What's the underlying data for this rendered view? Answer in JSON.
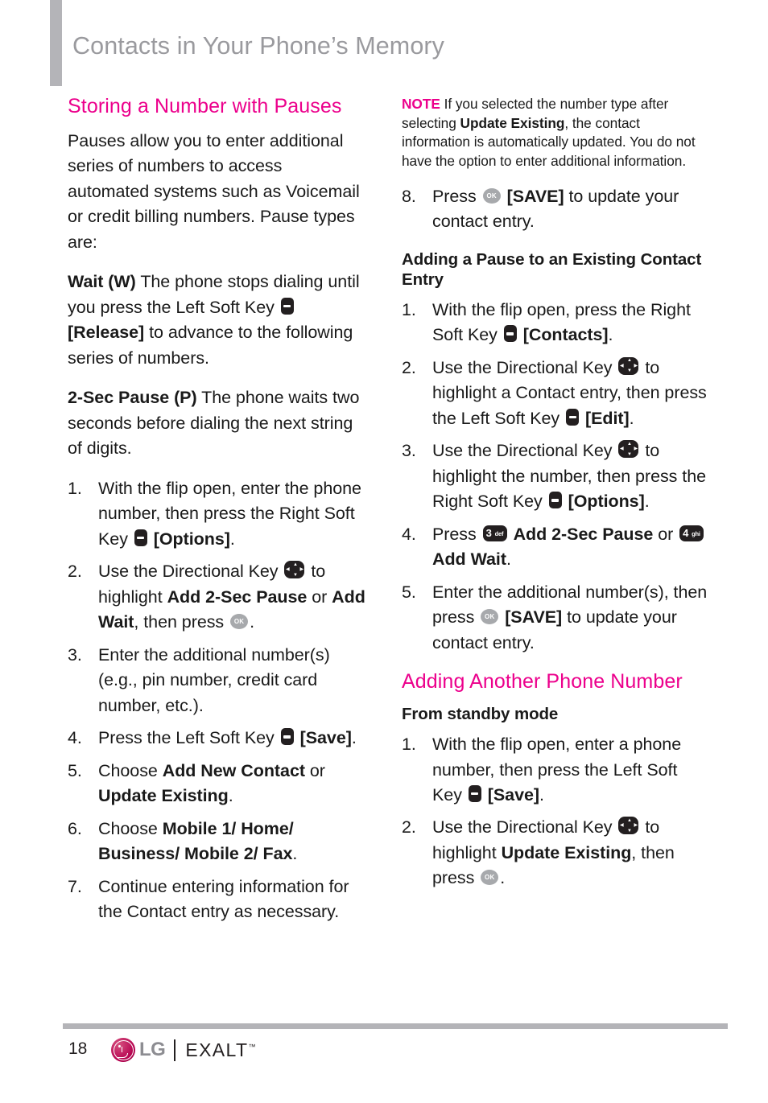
{
  "header": {
    "title": "Contacts in Your Phone’s Memory"
  },
  "icons": {
    "soft_key": "soft-key-icon",
    "directional_key": "directional-key-icon",
    "ok_key": "ok-key-icon",
    "num_key_3": "number-key-3-def-icon",
    "num_key_4": "number-key-4-ghi-icon",
    "ok_label": "OK",
    "num3_digit": "3",
    "num3_letters": "def",
    "num4_digit": "4",
    "num4_letters": "ghi"
  },
  "colors": {
    "accent_pink": "#ec008c",
    "header_gray": "#9a9a9e",
    "rule_gray": "#b4b4b8",
    "key_dark": "#231f20",
    "ok_gray": "#a7a9ac",
    "lg_crimson": "#b4004e"
  },
  "left_column": {
    "section_heading": "Storing a Number with Pauses",
    "intro_paragraph": "Pauses allow you to enter additional series of numbers to access automated systems such as Voicemail or credit billing numbers. Pause types are:",
    "wait_term": "Wait (W)",
    "wait_text_1": " The phone stops dialing until you press the Left Soft Key ",
    "wait_bracket": "[Release]",
    "wait_text_2": " to advance to the following series of numbers.",
    "twosec_term": "2-Sec Pause (P)",
    "twosec_text": " The phone waits two seconds before dialing the next string of digits.",
    "steps": [
      {
        "num": "1.",
        "parts": [
          {
            "t": "With the flip open, enter the phone number, then press the Right Soft Key "
          },
          {
            "icon": "soft"
          },
          {
            "t": " ",
            "bold": false
          },
          {
            "t": "[Options]",
            "bold": true
          },
          {
            "t": "."
          }
        ]
      },
      {
        "num": "2.",
        "parts": [
          {
            "t": "Use the Directional Key "
          },
          {
            "icon": "dir"
          },
          {
            "t": " to highlight "
          },
          {
            "t": "Add 2-Sec Pause",
            "bold": true
          },
          {
            "t": " or "
          },
          {
            "t": "Add Wait",
            "bold": true
          },
          {
            "t": ", then press "
          },
          {
            "icon": "ok"
          },
          {
            "t": "."
          }
        ]
      },
      {
        "num": "3.",
        "parts": [
          {
            "t": "Enter the additional number(s) (e.g., pin number, credit card number, etc.)."
          }
        ]
      },
      {
        "num": "4.",
        "parts": [
          {
            "t": "Press the Left Soft Key "
          },
          {
            "icon": "soft"
          },
          {
            "t": " "
          },
          {
            "t": "[Save]",
            "bold": true
          },
          {
            "t": "."
          }
        ]
      },
      {
        "num": "5.",
        "parts": [
          {
            "t": "Choose "
          },
          {
            "t": "Add New Contact",
            "bold": true
          },
          {
            "t": " or "
          },
          {
            "t": "Update Existing",
            "bold": true
          },
          {
            "t": "."
          }
        ]
      },
      {
        "num": "6.",
        "parts": [
          {
            "t": "Choose "
          },
          {
            "t": "Mobile 1/ Home/ Business/ Mobile 2/ Fax",
            "bold": true
          },
          {
            "t": "."
          }
        ]
      },
      {
        "num": "7.",
        "parts": [
          {
            "t": "Continue entering information for the Contact entry as necessary."
          }
        ]
      }
    ]
  },
  "right_column": {
    "note_label": "NOTE",
    "note_text_1": " If you selected the number type after selecting ",
    "note_bold": "Update Existing",
    "note_text_2": ", the contact information is automatically updated. You do not have the option to enter additional information.",
    "step8": {
      "num": "8.",
      "text_1": "Press ",
      "bracket": "[SAVE]",
      "text_2": " to update your contact entry."
    },
    "sub_heading_1": "Adding a Pause to an Existing Contact Entry",
    "steps_pause": [
      {
        "num": "1.",
        "parts": [
          {
            "t": "With the flip open, press the Right Soft Key "
          },
          {
            "icon": "soft"
          },
          {
            "t": " "
          },
          {
            "t": "[Contacts]",
            "bold": true
          },
          {
            "t": "."
          }
        ]
      },
      {
        "num": "2.",
        "parts": [
          {
            "t": "Use the Directional Key "
          },
          {
            "icon": "dir"
          },
          {
            "t": " to highlight a Contact entry, then press the Left Soft Key "
          },
          {
            "icon": "soft"
          },
          {
            "t": " "
          },
          {
            "t": "[Edit]",
            "bold": true
          },
          {
            "t": "."
          }
        ]
      },
      {
        "num": "3.",
        "parts": [
          {
            "t": "Use the Directional Key "
          },
          {
            "icon": "dir"
          },
          {
            "t": " to highlight the number, then press the Right Soft Key "
          },
          {
            "icon": "soft"
          },
          {
            "t": " "
          },
          {
            "t": "[Options]",
            "bold": true
          },
          {
            "t": "."
          }
        ]
      },
      {
        "num": "4.",
        "parts": [
          {
            "t": "Press "
          },
          {
            "icon": "num3"
          },
          {
            "t": " "
          },
          {
            "t": "Add 2-Sec Pause",
            "bold": true
          },
          {
            "t": " or "
          },
          {
            "icon": "num4"
          },
          {
            "t": " "
          },
          {
            "t": "Add Wait",
            "bold": true
          },
          {
            "t": "."
          }
        ]
      },
      {
        "num": "5.",
        "parts": [
          {
            "t": "Enter the additional number(s), then press "
          },
          {
            "icon": "ok"
          },
          {
            "t": " "
          },
          {
            "t": "[SAVE]",
            "bold": true
          },
          {
            "t": " to update your contact entry."
          }
        ]
      }
    ],
    "section_heading_2": "Adding Another Phone Number",
    "sub_heading_2": "From standby mode",
    "steps_standby": [
      {
        "num": "1.",
        "parts": [
          {
            "t": "With the flip open, enter a phone number, then press the Left Soft Key "
          },
          {
            "icon": "soft"
          },
          {
            "t": " "
          },
          {
            "t": "[Save]",
            "bold": true
          },
          {
            "t": "."
          }
        ]
      },
      {
        "num": "2.",
        "parts": [
          {
            "t": "Use the Directional Key "
          },
          {
            "icon": "dir"
          },
          {
            "t": " to highlight "
          },
          {
            "t": "Update Existing",
            "bold": true
          },
          {
            "t": ", then press "
          },
          {
            "icon": "ok"
          },
          {
            "t": "."
          }
        ]
      }
    ]
  },
  "footer": {
    "page_number": "18",
    "brand_lg": "LG",
    "brand_model": "EXALT",
    "trademark": "™"
  }
}
